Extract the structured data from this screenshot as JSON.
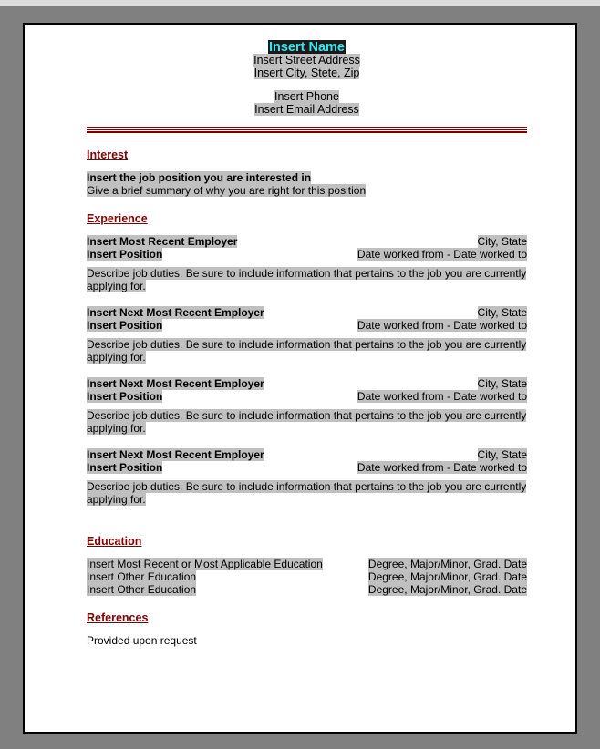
{
  "document": {
    "type": "resume-template",
    "header": {
      "name": "Insert Name",
      "street": "Insert Street Address",
      "city_state_zip": "Insert City, Stete, Zip",
      "phone": "Insert Phone",
      "email": "Insert Email Address"
    },
    "sections": {
      "interest": {
        "heading": "Interest",
        "position_line": "Insert the job position you are interested in",
        "summary_line": "Give a brief summary of why you are right for this position"
      },
      "experience": {
        "heading": "Experience",
        "entries": [
          {
            "employer": "Insert Most Recent Employer",
            "location": "City, State",
            "position": "Insert Position",
            "dates": "Date worked from - Date worked to",
            "description": "Describe job duties. Be sure to include information that pertains to the job you are currently applying for."
          },
          {
            "employer": "Insert Next Most Recent Employer",
            "location": "City, State",
            "position": "Insert Position",
            "dates": "Date worked from - Date worked to",
            "description": "Describe job duties. Be sure to include information that pertains to the job you are currently applying for."
          },
          {
            "employer": "Insert Next Most Recent Employer",
            "location": "City, State",
            "position": "Insert Position",
            "dates": "Date worked from - Date worked to",
            "description": "Describe job duties. Be sure to include information that pertains to the job you are currently applying for."
          },
          {
            "employer": "Insert Next Most Recent Employer",
            "location": "City, State",
            "position": "Insert Position",
            "dates": "Date worked from - Date worked to",
            "description": "Describe job duties. Be sure to include information that pertains to the job you are currently applying for."
          }
        ]
      },
      "education": {
        "heading": "Education",
        "rows": [
          {
            "school": "Insert Most Recent or Most Applicable Education",
            "detail": "Degree, Major/Minor, Grad. Date"
          },
          {
            "school": "Insert Other Education",
            "detail": "Degree, Major/Minor, Grad. Date"
          },
          {
            "school": "Insert Other Education",
            "detail": "Degree, Major/Minor, Grad. Date"
          }
        ]
      },
      "references": {
        "heading": "References",
        "body": "Provided upon request"
      }
    }
  },
  "colors": {
    "heading": "#800000",
    "rule": "#800000",
    "field_highlight": "#c0c0c0",
    "selection_background": "#1a1a1a",
    "selection_text": "#33e6f0",
    "page_background": "#ffffff",
    "window_frame": "#808080",
    "outer_background": "#dcdcdc"
  }
}
